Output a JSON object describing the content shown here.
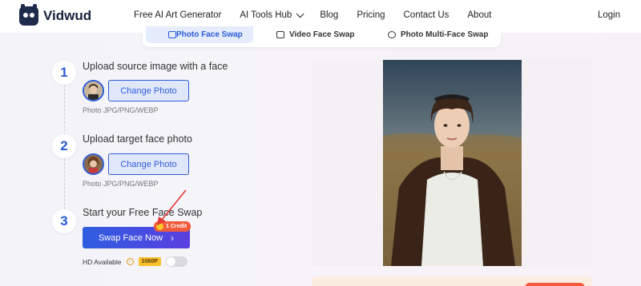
{
  "header": {
    "brand": "Vidwud",
    "nav": [
      {
        "label": "Free AI Art Generator"
      },
      {
        "label": "AI Tools Hub",
        "has_dropdown": true
      },
      {
        "label": "Blog"
      },
      {
        "label": "Pricing"
      },
      {
        "label": "Contact Us"
      },
      {
        "label": "About"
      }
    ],
    "login": "Login"
  },
  "tabs": [
    {
      "label": "Photo Face Swap",
      "active": true
    },
    {
      "label": "Video Face Swap",
      "active": false
    },
    {
      "label": "Photo Multi-Face Swap",
      "active": false
    }
  ],
  "steps": [
    {
      "number": "1",
      "title": "Upload source image with a face",
      "button": "Change Photo",
      "hint": "Photo JPG/PNG/WEBP"
    },
    {
      "number": "2",
      "title": "Upload target face photo",
      "button": "Change Photo",
      "hint": "Photo JPG/PNG/WEBP"
    },
    {
      "number": "3",
      "title": "Start your Free Face Swap"
    }
  ],
  "swap_button": {
    "label": "Swap Face Now",
    "arrow": "›"
  },
  "credit_badge": "1 Credit",
  "hd": {
    "label": "HD Available",
    "badge": "1080P",
    "enabled": false
  },
  "colors": {
    "accent": "#2f5ed8",
    "credit": "#f15a3a",
    "hd_badge": "#f6c12d"
  }
}
